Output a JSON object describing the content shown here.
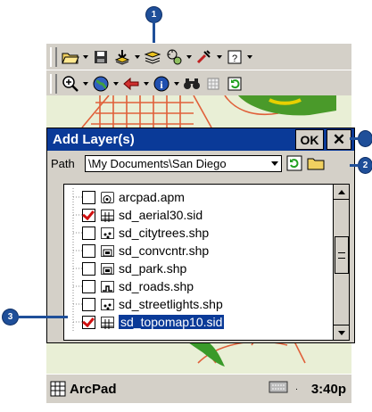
{
  "callouts": {
    "c1": "1",
    "c2": "2",
    "c3": "3"
  },
  "toolbar1": {
    "icons": [
      "open-folder-icon",
      "save-icon",
      "add-layer-icon",
      "layers-icon",
      "gps-icon",
      "tools-icon",
      "help-icon"
    ]
  },
  "toolbar2": {
    "icons": [
      "zoom-in-icon",
      "globe-icon",
      "back-arrow-icon",
      "info-icon",
      "binoculars-icon",
      "grid-icon",
      "refresh-icon"
    ]
  },
  "dialog": {
    "title": "Add Layer(s)",
    "ok_label": "OK",
    "close_label": "✕",
    "path_label": "Path",
    "path_value": "\\My Documents\\San Diego",
    "files": [
      {
        "name": "arcpad.apm",
        "checked": false
      },
      {
        "name": "sd_aerial30.sid",
        "checked": true
      },
      {
        "name": "sd_citytrees.shp",
        "checked": false
      },
      {
        "name": "sd_convcntr.shp",
        "checked": false
      },
      {
        "name": "sd_park.shp",
        "checked": false
      },
      {
        "name": "sd_roads.shp",
        "checked": false
      },
      {
        "name": "sd_streetlights.shp",
        "checked": false
      },
      {
        "name": "sd_topomap10.sid",
        "checked": true
      }
    ]
  },
  "taskbar": {
    "app_name": "ArcPad",
    "time": "3:40p"
  },
  "colors": {
    "titlebar": "#0a3a98",
    "callout": "#1f4f99",
    "check": "#d01010"
  }
}
